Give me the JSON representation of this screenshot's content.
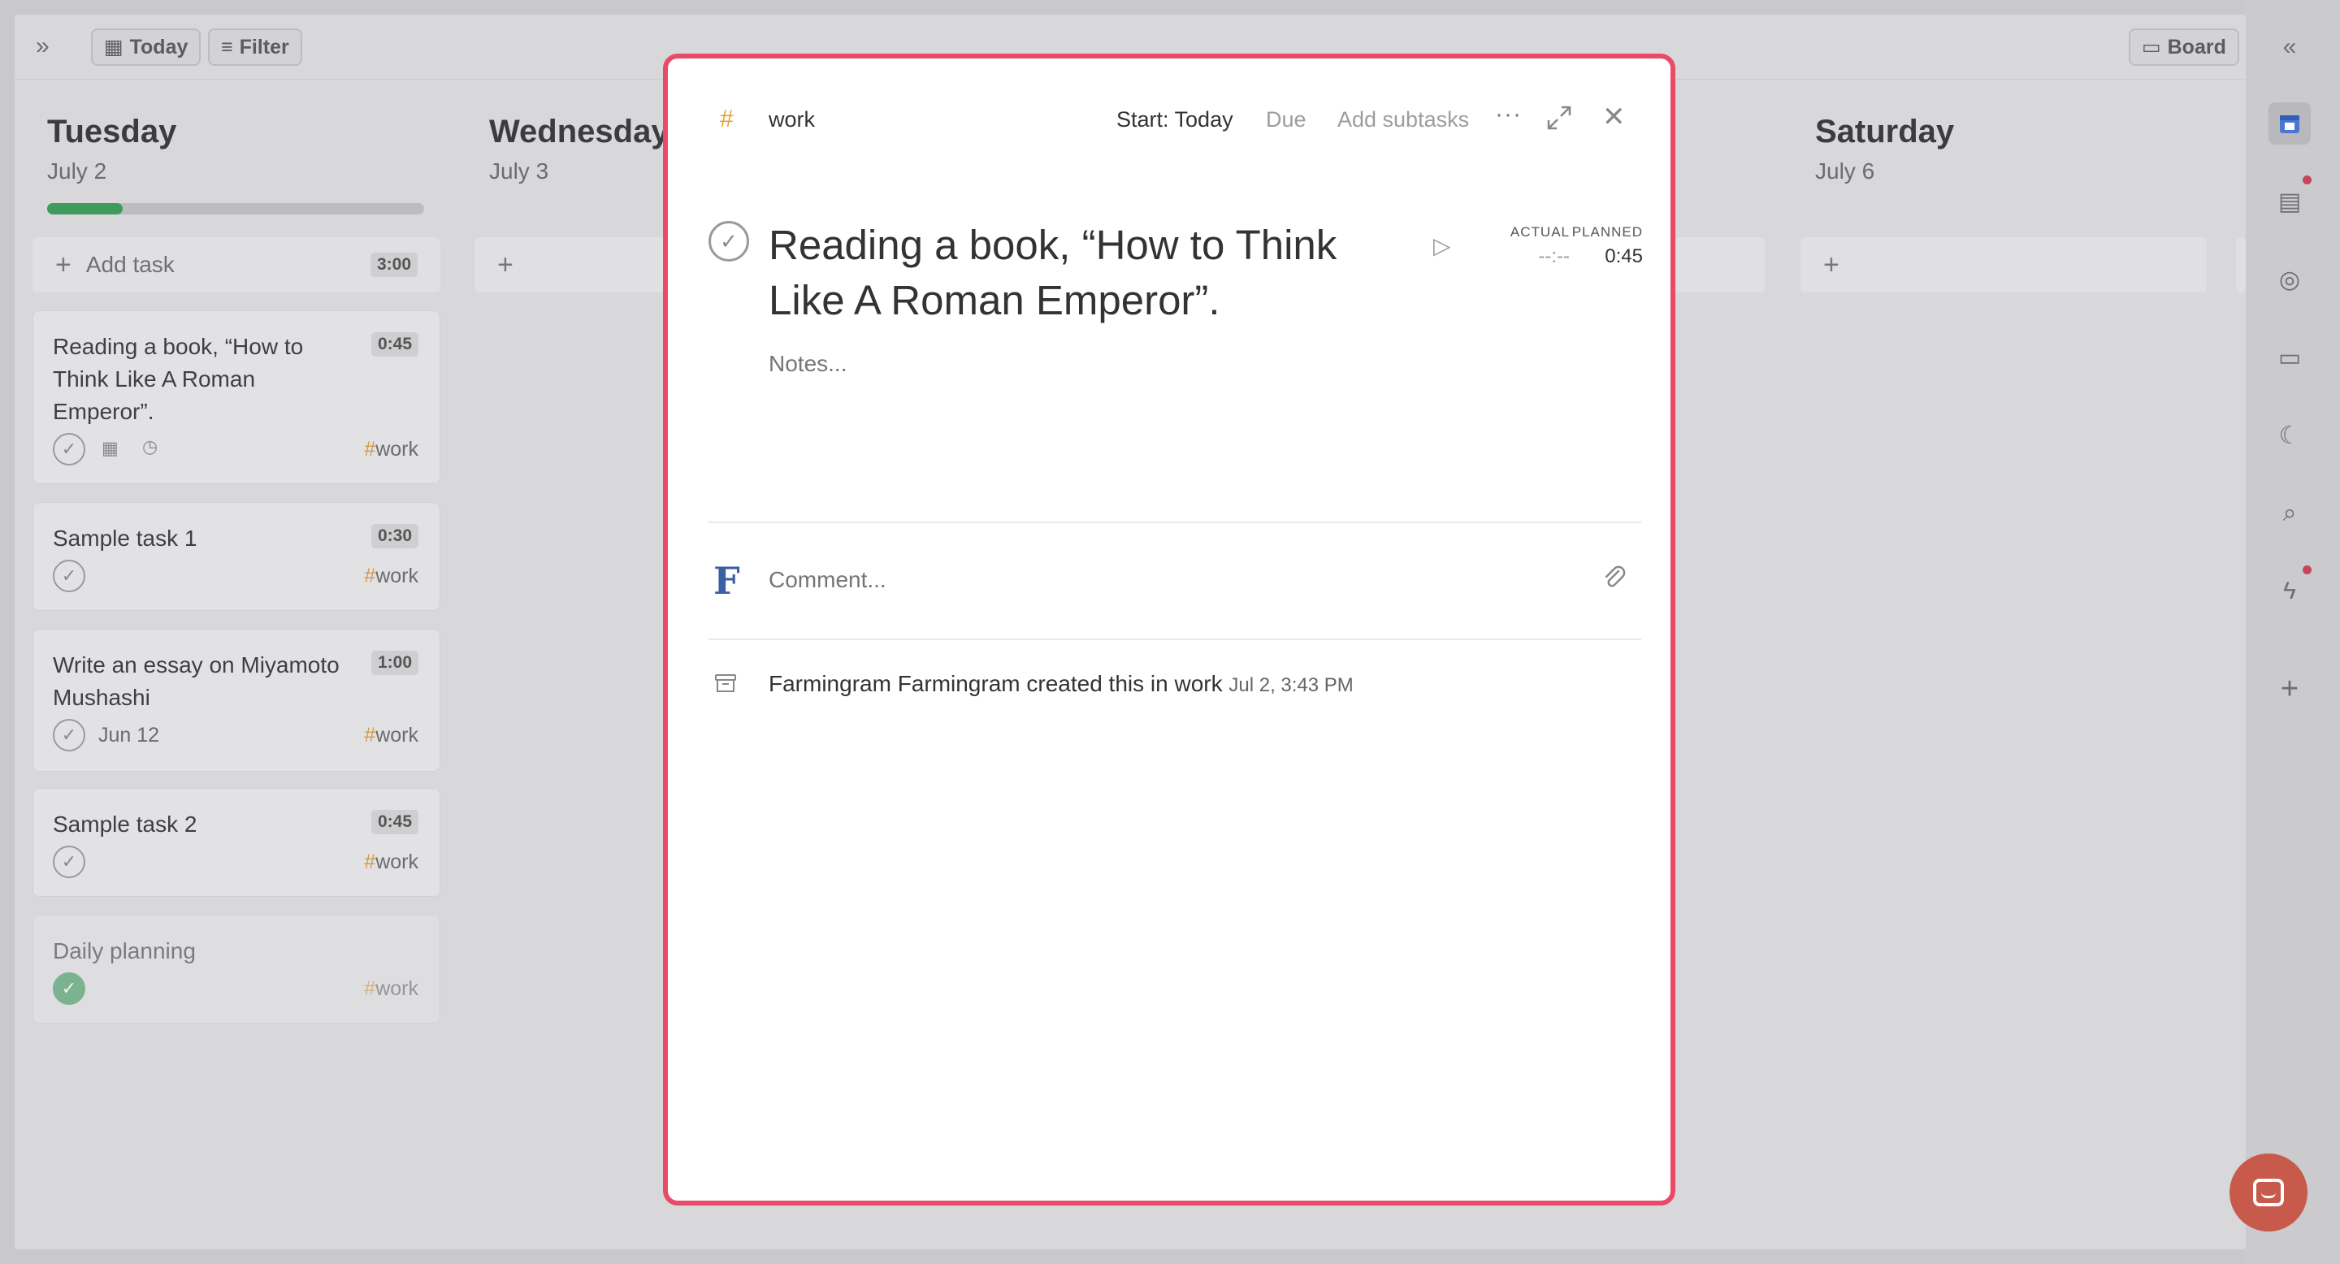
{
  "topbar": {
    "today_label": "Today",
    "filter_label": "Filter",
    "board_label": "Board"
  },
  "columns": [
    {
      "day": "Tuesday",
      "date": "July 2",
      "progress": 0.2,
      "add_label": "Add task",
      "total_time": "3:00"
    },
    {
      "day": "Wednesday",
      "date": "July 3"
    },
    {
      "day": "Saturday",
      "date": "July 6"
    }
  ],
  "tasks": [
    {
      "title": "Reading a book, “How to Think Like A Roman Emperor”.",
      "time": "0:45",
      "tag": "work"
    },
    {
      "title": "Sample task 1",
      "time": "0:30",
      "tag": "work"
    },
    {
      "title": "Write an essay on Miyamoto Mushashi",
      "time": "1:00",
      "tag": "work",
      "due": "Jun 12"
    },
    {
      "title": "Sample task 2",
      "time": "0:45",
      "tag": "work"
    },
    {
      "title": "Daily planning",
      "tag": "work",
      "done": true
    }
  ],
  "modal": {
    "tag_hash": "#",
    "tag_name": "work",
    "start_label": "Start: Today",
    "due_label": "Due",
    "add_subtasks_label": "Add subtasks",
    "more_label": "···",
    "close_label": "✕",
    "title": "Reading a book, “How to Think Like A Roman Emperor”.",
    "actual_label": "ACTUAL",
    "actual_value": "--:--",
    "planned_label": "PLANNED",
    "planned_value": "0:45",
    "notes_placeholder": "Notes...",
    "avatar_letter": "F",
    "comment_placeholder": "Comment...",
    "activity_text": "Farmingram Farmingram created this in work",
    "activity_time": "Jul 2, 3:43 PM"
  },
  "colors": {
    "accent_border": "#e84a68",
    "tag_hash": "#e6a23c",
    "progress_green": "#3f9a5e",
    "chat_bubble": "#c85a4c"
  }
}
